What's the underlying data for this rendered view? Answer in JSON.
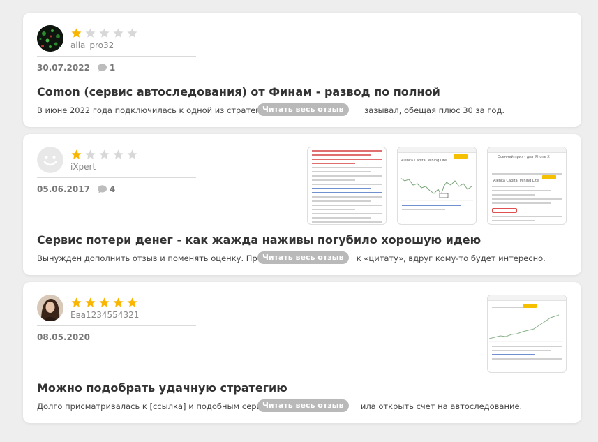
{
  "colors": {
    "star_filled": "#f9b500",
    "star_empty": "#d8d8d8",
    "readmore_bg": "#b9b9b9"
  },
  "reviews": [
    {
      "username": "alla_pro32",
      "rating": 1,
      "date": "30.07.2022",
      "comments": "1",
      "title": "Comon (сервис автоследования) от Финам - развод по полной",
      "excerpt_start": "В июне 2022 года подключилась к одной из стратегий",
      "excerpt_end": "зазывал, обещая плюс 30 за год.",
      "read_more": "Читать весь отзыв"
    },
    {
      "username": "iXpert",
      "rating": 1,
      "date": "05.06.2017",
      "comments": "4",
      "title": "Сервис потери денег - как жажда наживы погубило хорошую идею",
      "excerpt_start": "Вынужден дополнить отзыв и поменять оценку. Про",
      "excerpt_end": "к «цитату», вдруг кому-то будет интересно.",
      "read_more": "Читать весь отзыв",
      "thumb_labels": [
        "Alenka Capital Mining Lite",
        "Alenka Capital Mining Lite",
        "Осенний приз - два iPhone X"
      ]
    },
    {
      "username": "Ева1234554321",
      "rating": 5,
      "date": "08.05.2020",
      "title": "Можно подобрать удачную стратегию",
      "excerpt_start": "Долго присматривалась к [ссылка] и подобным серви",
      "excerpt_end": "ила открыть счет на автоследование.",
      "read_more": "Читать весь отзыв"
    }
  ]
}
